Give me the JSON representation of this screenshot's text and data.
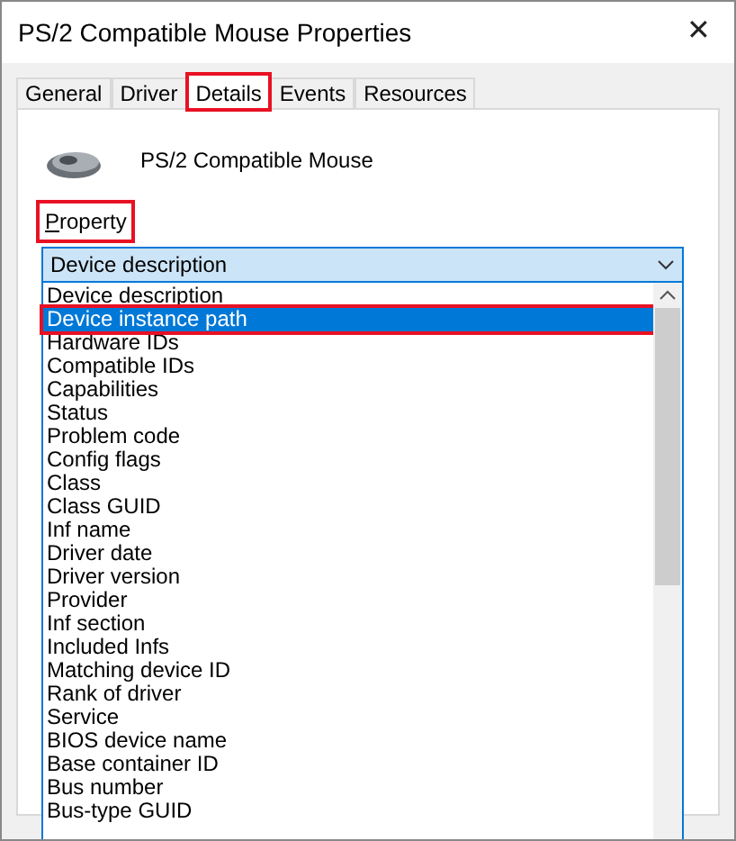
{
  "window": {
    "title": "PS/2 Compatible Mouse Properties",
    "close": "✕"
  },
  "tabs": [
    {
      "label": "General",
      "selected": false,
      "highlighted": false
    },
    {
      "label": "Driver",
      "selected": false,
      "highlighted": false
    },
    {
      "label": "Details",
      "selected": true,
      "highlighted": true
    },
    {
      "label": "Events",
      "selected": false,
      "highlighted": false
    },
    {
      "label": "Resources",
      "selected": false,
      "highlighted": false
    }
  ],
  "device": {
    "name": "PS/2 Compatible Mouse"
  },
  "property": {
    "access_key": "P",
    "label_rest": "roperty",
    "highlighted": true
  },
  "combo": {
    "value": "Device description",
    "expanded": true
  },
  "options": [
    {
      "label": "Device description",
      "selected": false,
      "highlighted": false
    },
    {
      "label": "Device instance path",
      "selected": true,
      "highlighted": true
    },
    {
      "label": "Hardware IDs",
      "selected": false,
      "highlighted": false
    },
    {
      "label": "Compatible IDs",
      "selected": false,
      "highlighted": false
    },
    {
      "label": "Capabilities",
      "selected": false,
      "highlighted": false
    },
    {
      "label": "Status",
      "selected": false,
      "highlighted": false
    },
    {
      "label": "Problem code",
      "selected": false,
      "highlighted": false
    },
    {
      "label": "Config flags",
      "selected": false,
      "highlighted": false
    },
    {
      "label": "Class",
      "selected": false,
      "highlighted": false
    },
    {
      "label": "Class GUID",
      "selected": false,
      "highlighted": false
    },
    {
      "label": "Inf name",
      "selected": false,
      "highlighted": false
    },
    {
      "label": "Driver date",
      "selected": false,
      "highlighted": false
    },
    {
      "label": "Driver version",
      "selected": false,
      "highlighted": false
    },
    {
      "label": "Provider",
      "selected": false,
      "highlighted": false
    },
    {
      "label": "Inf section",
      "selected": false,
      "highlighted": false
    },
    {
      "label": "Included Infs",
      "selected": false,
      "highlighted": false
    },
    {
      "label": "Matching device ID",
      "selected": false,
      "highlighted": false
    },
    {
      "label": "Rank of driver",
      "selected": false,
      "highlighted": false
    },
    {
      "label": "Service",
      "selected": false,
      "highlighted": false
    },
    {
      "label": "BIOS device name",
      "selected": false,
      "highlighted": false
    },
    {
      "label": "Base container ID",
      "selected": false,
      "highlighted": false
    },
    {
      "label": "Bus number",
      "selected": false,
      "highlighted": false
    },
    {
      "label": "Bus-type GUID",
      "selected": false,
      "highlighted": false
    }
  ]
}
